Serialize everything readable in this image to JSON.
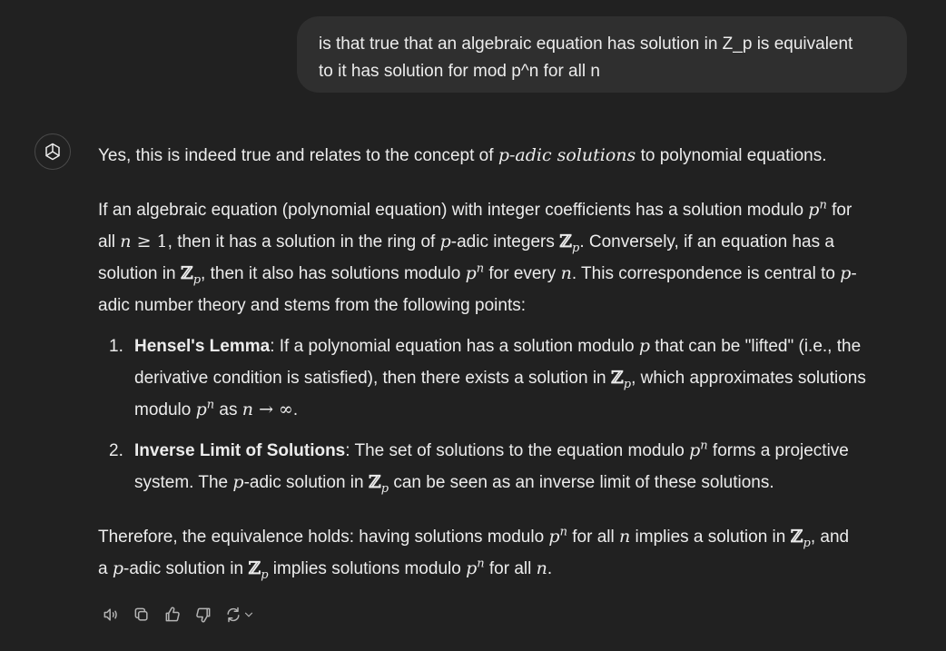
{
  "user_message": {
    "line1": "is that true that an algebraic equation has solution in Z_p is equivalent",
    "line2": "to it has solution for mod p^n for all n"
  },
  "assistant": {
    "intro_before": "Yes, this is indeed true and relates to the concept of ",
    "intro_em": "p-adic solutions",
    "intro_after": " to polynomial equations.",
    "p2": {
      "l1_a": "If an algebraic equation (polynomial equation) with integer coefficients has a solution modulo ",
      "l1_b": " for",
      "l2_a": "all ",
      "l2_b": ", then it has a solution in the ring of ",
      "l2_c": "-adic integers ",
      "l2_d": ". Conversely, if an equation has a",
      "l3_a": "solution in ",
      "l3_b": ", then it also has solutions modulo ",
      "l3_c": " for every ",
      "l3_d": ". This correspondence is central to ",
      "l3_e": "-",
      "l4": "adic number theory and stems from the following points:"
    },
    "list": [
      {
        "num": "1.",
        "title": "Hensel's Lemma",
        "l1_a": ": If a polynomial equation has a solution modulo ",
        "l1_b": " that can be \"lifted\" (i.e., the",
        "l2_a": "derivative condition is satisfied), then there exists a solution in ",
        "l2_b": ", which approximates solutions",
        "l3_a": "modulo ",
        "l3_b": " as "
      },
      {
        "num": "2.",
        "title": "Inverse Limit of Solutions",
        "l1_a": ": The set of solutions to the equation modulo ",
        "l1_b": " forms a projective",
        "l2_a": "system. The ",
        "l2_b": "-adic solution in ",
        "l2_c": " can be seen as an inverse limit of these solutions."
      }
    ],
    "conclusion": {
      "l1_a": "Therefore, the equivalence holds: having solutions modulo ",
      "l1_b": " for all ",
      "l1_c": " implies a solution in ",
      "l1_d": ", and",
      "l2_a": "a ",
      "l2_b": "-adic solution in ",
      "l2_c": " implies solutions modulo ",
      "l2_d": " for all "
    }
  },
  "math": {
    "p": "p",
    "n": "n",
    "sup_n": "n",
    "Z": "ℤ",
    "sub_p": "p",
    "geq1": " ≥ 1",
    "arrow_inf": " → ∞",
    "dot": ".",
    "comma": ","
  },
  "toolbar": {
    "icons": [
      "speaker-icon",
      "copy-icon",
      "thumbs-up-icon",
      "thumbs-down-icon",
      "regenerate-icon"
    ]
  }
}
